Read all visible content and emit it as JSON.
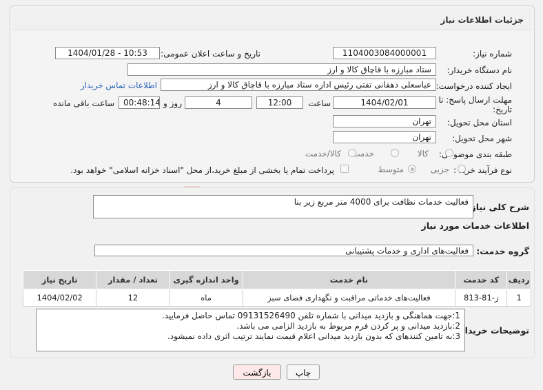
{
  "header": {
    "title": "جزئیات اطلاعات نیاز"
  },
  "form": {
    "need_number_label": "شماره نیاز:",
    "need_number": "1104003084000001",
    "announce_label": "تاریخ و ساعت اعلان عمومی:",
    "announce_value": "1404/01/28 - 10:53",
    "buyer_org_label": "نام دستگاه خریدار:",
    "buyer_org": "ستاد مبارزه با قاچاق کالا و ارز",
    "requester_label": "ایجاد کننده درخواست:",
    "requester": "عباسعلی  دهقانی تفتی رئیس اداره ستاد مبارزه با قاچاق کالا و ارز",
    "contact_link": "اطلاعات تماس خریدار",
    "deadline_label_1": "مهلت ارسال پاسخ: تا",
    "deadline_label_2": "تاریخ:",
    "deadline_date": "1404/02/01",
    "time_label": "ساعت",
    "deadline_time": "12:00",
    "days_value": "4",
    "days_label": "روز و",
    "remaining_time": "00:48:14",
    "remaining_label": "ساعت باقی مانده",
    "province_label": "استان محل تحویل:",
    "province": "تهران",
    "city_label": "شهر محل تحویل:",
    "city": "تهران",
    "category_label": "طبقه بندی موضوعی:",
    "category_options": {
      "goods": "کالا",
      "service": "خدمت",
      "goods_service": "کالا/خدمت"
    },
    "process_label": "نوع فرآیند خرید :",
    "process_options": {
      "partial": "جزیی",
      "medium": "متوسط"
    },
    "payment_note": "پرداخت تمام یا بخشی از مبلغ خرید،از محل \"اسناد خزانه اسلامی\" خواهد بود."
  },
  "description": {
    "label": "شرح کلی نیاز:",
    "value": "فعالیت خدمات نظافت برای 4000 متر مربع زیر بنا"
  },
  "services": {
    "section_title": "اطلاعات خدمات مورد نیاز",
    "group_label": "گروه خدمت:",
    "group_value": "فعالیت‌های اداری و خدمات پشتیبانی",
    "columns": [
      "ردیف",
      "کد خدمت",
      "نام خدمت",
      "واحد اندازه گیری",
      "تعداد / مقدار",
      "تاریخ نیاز"
    ],
    "rows": [
      [
        "1",
        "ز-81-813",
        "فعالیت‌های خدماتی مراقبت و نگهداری فضای سبز",
        "ماه",
        "12",
        "1404/02/02"
      ]
    ]
  },
  "buyer_notes": {
    "label": "توضیحات خریدار:",
    "line1": "1:جهت هماهنگی و بازدید میدانی با شماره تلفن 09131526490 تماس حاصل فرمایید.",
    "line2": "2:بازدید میدانی و پر کردن فرم مربوط به بازدید الزامی می باشد.",
    "line3": "3:به تامین کنندهای که بدون بازدید میدانی اعلام قیمت نمایند ترتیب اثری داده نمیشود."
  },
  "buttons": {
    "print": "چاپ",
    "back": "بازگشت"
  },
  "colors": {
    "back_button_bg": "#fde9e9",
    "link": "#2a62b8",
    "table_header": "#d8d8d8"
  }
}
